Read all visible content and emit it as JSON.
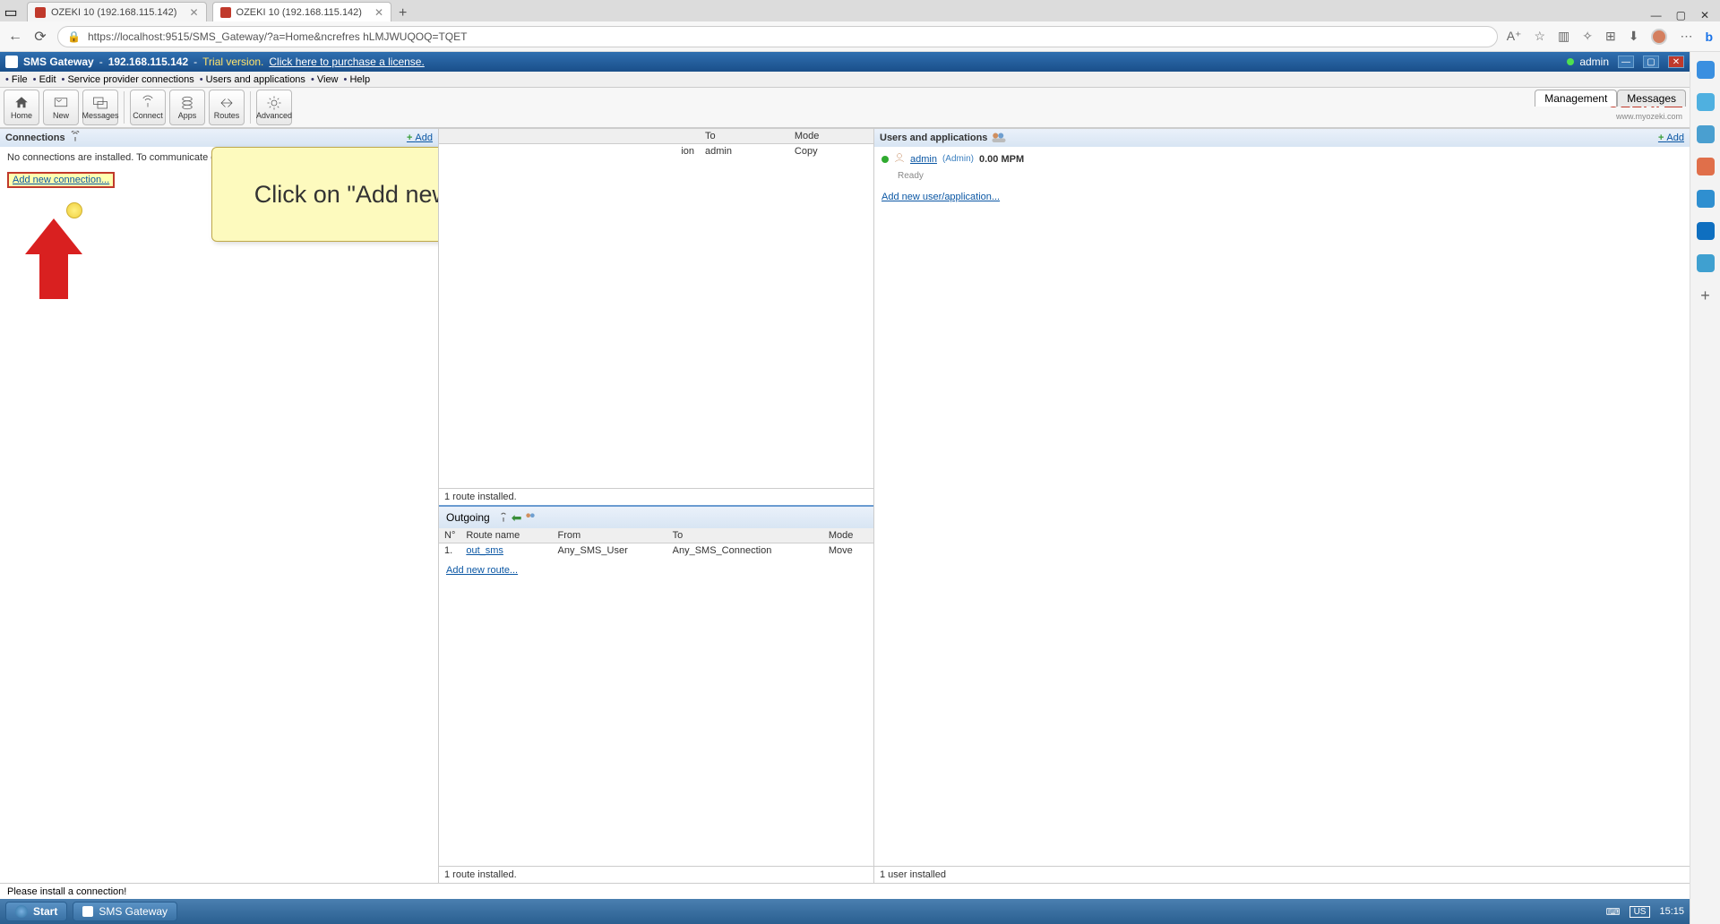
{
  "browser": {
    "tabs": [
      {
        "title": "OZEKI 10 (192.168.115.142)"
      },
      {
        "title": "OZEKI 10 (192.168.115.142)"
      }
    ],
    "url": "https://localhost:9515/SMS_Gateway/?a=Home&ncrefres hLMJWUQOQ=TQET",
    "win": {
      "min": "—",
      "max": "▢",
      "close": "✕"
    }
  },
  "app_header": {
    "title_app": "SMS Gateway",
    "title_ip": "192.168.115.142",
    "trial": "Trial version.",
    "buy": "Click here to purchase a license.",
    "user": "admin"
  },
  "menubar": [
    "File",
    "Edit",
    "Service provider connections",
    "Users and applications",
    "View",
    "Help"
  ],
  "toolbar": [
    {
      "label": "Home",
      "icon": "home"
    },
    {
      "label": "New",
      "icon": "new"
    },
    {
      "label": "Messages",
      "icon": "messages"
    },
    {
      "label": "Connect",
      "icon": "connect"
    },
    {
      "label": "Apps",
      "icon": "apps"
    },
    {
      "label": "Routes",
      "icon": "routes"
    },
    {
      "label": "Advanced",
      "icon": "advanced"
    }
  ],
  "logo": {
    "brand": "OZEKI",
    "url": "www.myozeki.com"
  },
  "right_tabs": {
    "a": "Management",
    "b": "Messages"
  },
  "connections": {
    "title": "Connections",
    "add": "Add",
    "empty": "No connections are installed. To communicate on the link bellow!",
    "addlink": "Add new connection..."
  },
  "callout": "Click on \"Add new connection...\"",
  "incoming": {
    "headers": {
      "to": "To",
      "mode": "Mode"
    },
    "row": {
      "conn": "ion",
      "to": "admin",
      "mode": "Copy"
    },
    "footer": "1 route installed."
  },
  "outgoing": {
    "title": "Outgoing",
    "headers": {
      "no": "N°",
      "name": "Route name",
      "from": "From",
      "to": "To",
      "mode": "Mode"
    },
    "row": {
      "no": "1.",
      "name": "out_sms",
      "from": "Any_SMS_User",
      "to": "Any_SMS_Connection",
      "mode": "Move"
    },
    "addroute": "Add new route...",
    "footer": "1 route installed."
  },
  "users": {
    "title": "Users and applications",
    "add": "Add",
    "row": {
      "name": "admin",
      "role": "(Admin)",
      "mpm": "0.00 MPM",
      "ready": "Ready"
    },
    "addapp": "Add new user/application...",
    "footer": "1 user installed"
  },
  "statusbar": {
    "left": "Please install a connection!"
  },
  "taskbar": {
    "start": "Start",
    "app": "SMS Gateway",
    "time": "15:15",
    "kb": "US"
  }
}
